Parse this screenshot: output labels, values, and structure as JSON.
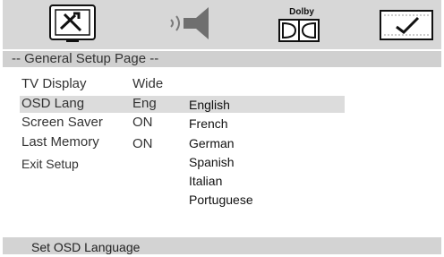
{
  "icons": [
    {
      "name": "general-setup-icon"
    },
    {
      "name": "audio-setup-icon"
    },
    {
      "name": "dolby-setup-icon",
      "label": "Dolby"
    },
    {
      "name": "preference-setup-icon"
    }
  ],
  "page_title": "-- General Setup Page --",
  "menu": [
    {
      "label": "TV Display",
      "value": "Wide"
    },
    {
      "label": "OSD Lang",
      "value": "Eng",
      "selected": true
    },
    {
      "label": "Screen Saver",
      "value": "ON"
    },
    {
      "label": "Last Memory",
      "value": "ON"
    },
    {
      "label": "Exit Setup",
      "value": ""
    }
  ],
  "language_options": [
    "English",
    "French",
    "German",
    "Spanish",
    "Italian",
    "Portuguese"
  ],
  "highlighted_option": "English",
  "status_text": "Set OSD Language",
  "colors": {
    "bar_background": "#d7d7d7",
    "highlight": "#dcdcdc",
    "text": "#333333"
  }
}
